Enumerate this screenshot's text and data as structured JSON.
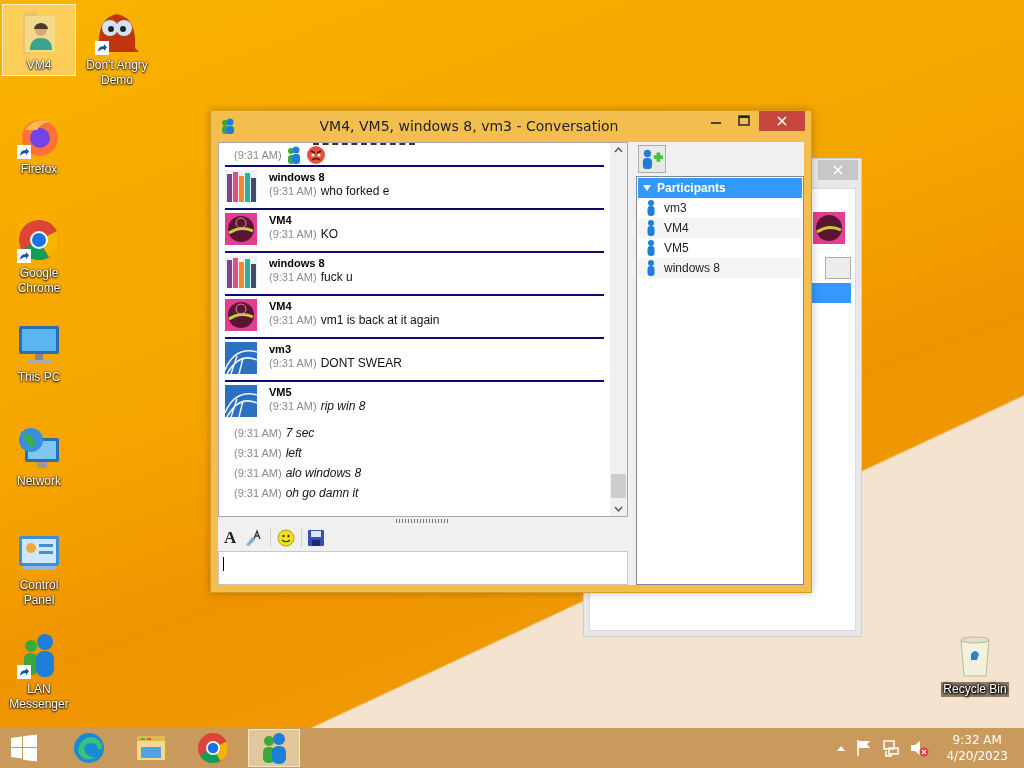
{
  "desktop_icons": [
    {
      "label": "VM4",
      "shortcut": false,
      "selected": true
    },
    {
      "label": "Don't Angry Demo",
      "shortcut": true,
      "selected": false
    },
    {
      "label": "Firefox",
      "shortcut": true,
      "selected": false
    },
    {
      "label": "Google Chrome",
      "shortcut": true,
      "selected": false
    },
    {
      "label": "This PC",
      "shortcut": false,
      "selected": false
    },
    {
      "label": "Network",
      "shortcut": false,
      "selected": false
    },
    {
      "label": "Control Panel",
      "shortcut": false,
      "selected": false
    },
    {
      "label": "LAN Messenger",
      "shortcut": true,
      "selected": false
    },
    {
      "label": "Recycle Bin",
      "shortcut": false,
      "selected": false
    }
  ],
  "window": {
    "title": "VM4, VM5, windows 8, vm3 - Conversation",
    "messages": [
      {
        "kind": "emoticons",
        "time": "(9:31 AM)"
      },
      {
        "kind": "post",
        "sender": "windows 8",
        "time": "(9:31 AM)",
        "text": "who forked e",
        "italic": false
      },
      {
        "kind": "post",
        "sender": "VM4",
        "time": "(9:31 AM)",
        "text": "KO",
        "italic": false
      },
      {
        "kind": "post",
        "sender": "windows 8",
        "time": "(9:31 AM)",
        "text": "fuck u",
        "italic": false
      },
      {
        "kind": "post",
        "sender": "VM4",
        "time": "(9:31 AM)",
        "text": "vm1 is back at it again",
        "italic": false
      },
      {
        "kind": "post",
        "sender": "vm3",
        "time": "(9:31 AM)",
        "text": "DONT SWEAR",
        "italic": false
      },
      {
        "kind": "post",
        "sender": "VM5",
        "time": "(9:31 AM)",
        "text": "rip win 8",
        "italic": true
      },
      {
        "kind": "line",
        "time": "(9:31 AM)",
        "text": "7 sec",
        "italic": true
      },
      {
        "kind": "line",
        "time": "(9:31 AM)",
        "text": "left",
        "italic": true
      },
      {
        "kind": "line",
        "time": "(9:31 AM)",
        "text": "alo windows 8",
        "italic": true
      },
      {
        "kind": "line",
        "time": "(9:31 AM)",
        "text": "oh go damn it",
        "italic": true
      }
    ],
    "toolbar": {
      "font_glyph": "A"
    },
    "participants": {
      "header": "Participants",
      "expanded": true,
      "selected": true,
      "items": [
        {
          "name": "vm3",
          "selected": false
        },
        {
          "name": "VM4",
          "selected": false
        },
        {
          "name": "VM5",
          "selected": false
        },
        {
          "name": "windows 8",
          "selected": false
        }
      ]
    }
  },
  "taskbar": {
    "items": [
      {
        "active": false
      },
      {
        "active": false
      },
      {
        "active": false
      },
      {
        "active": true
      }
    ],
    "time": "9:32 AM",
    "date": "4/20/2023",
    "volume_muted": true
  }
}
